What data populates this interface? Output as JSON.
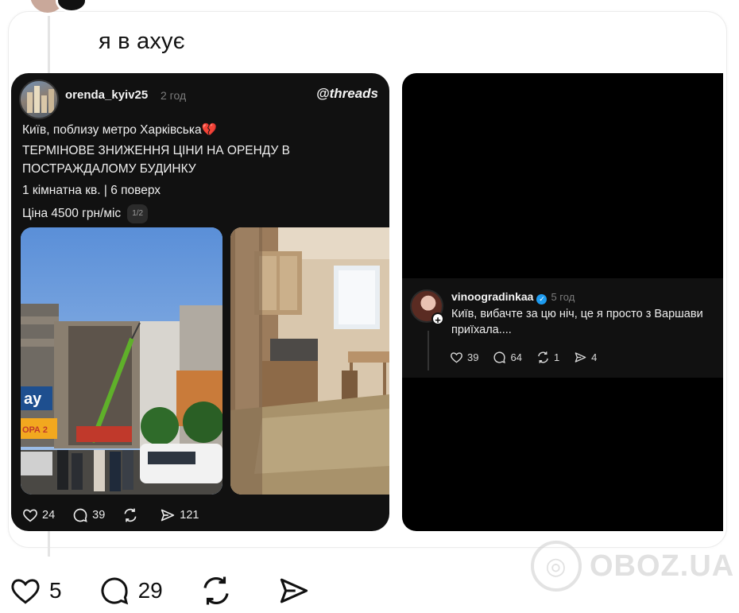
{
  "post": {
    "text": "я в ахує"
  },
  "left_card": {
    "username": "orenda_kyiv25",
    "time": "2 год",
    "brand": "@threads",
    "lines": [
      "Київ, поблизу метро Харківська",
      "ТЕРМІНОВЕ ЗНИЖЕННЯ ЦІНИ НА ОРЕНДУ В",
      "ПОСТРАЖДАЛОМУ БУДИНКУ",
      "1 кімнатна кв. | 6 поверх",
      "Ціна 4500 грн/міс"
    ],
    "broken_heart": "💔",
    "pager": "1/2",
    "photo1_sign": "ay",
    "photo1_sign2": "ОРА 2",
    "actions": {
      "likes": "24",
      "comments": "39",
      "shares": "121"
    }
  },
  "right_card": {
    "username": "vinoogradinkaa",
    "verified": "✓",
    "time": "5 год",
    "text": "Київ, вибачте за цю ніч, це я просто з Варшави приїхала....",
    "actions": {
      "likes": "39",
      "comments": "64",
      "reposts": "1",
      "shares": "4"
    }
  },
  "bottom": {
    "likes": "5",
    "comments": "29"
  },
  "watermark": "OBOZ.UA",
  "colors": {
    "card_bg": "#111111",
    "broken_heart": "#e0245e",
    "verified": "#1d9bf0"
  }
}
